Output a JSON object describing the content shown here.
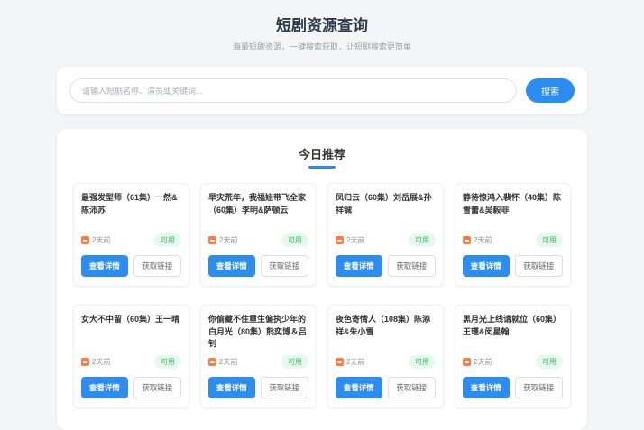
{
  "page": {
    "title": "短剧资源查询",
    "subtitle": "海量短剧资源，一键搜索获取，让短剧搜索更简单"
  },
  "search": {
    "placeholder": "请输入短剧名称、演员或关键词...",
    "button_label": "搜索"
  },
  "colors": {
    "accent_blue": "#2d8cf0",
    "status_green": "#3bbf6a",
    "calendar_orange": "#ff7a45"
  },
  "recommend": {
    "heading": "今日推荐",
    "actions": {
      "detail": "查看详情",
      "link": "获取链接"
    },
    "cards": [
      {
        "title": "最强发型师（61集）一然&陈沛苏",
        "time": "2天前",
        "status": "可用"
      },
      {
        "title": "旱灾荒年，我福娃带飞全家（60集）李明&萨顿云",
        "time": "2天前",
        "status": "可用"
      },
      {
        "title": "凤归云（60集）刘岳展&孙祥铖",
        "time": "2天前",
        "status": "可用"
      },
      {
        "title": "静待惊鸿入裴怀（40集）陈雪蕾&吴毅非",
        "time": "2天前",
        "status": "可用"
      },
      {
        "title": "女大不中留（60集）王一晴",
        "time": "2天前",
        "status": "可用"
      },
      {
        "title": "你偷藏不住重生偏执少年的白月光（80集）熊奕博＆吕钊",
        "time": "2天前",
        "status": "可用"
      },
      {
        "title": "夜色寄情人（108集）陈添祥&朱小雪",
        "time": "2天前",
        "status": "可用"
      },
      {
        "title": "黑月光上线请就位（60集）王瑾&闵星翰",
        "time": "2天前",
        "status": "可用"
      }
    ]
  }
}
